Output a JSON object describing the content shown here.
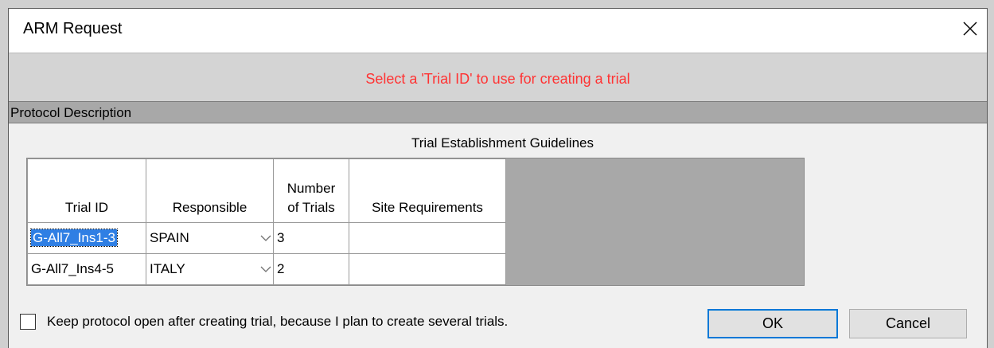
{
  "window": {
    "title": "ARM Request",
    "close_icon": "close-icon"
  },
  "banner": {
    "message": "Select a 'Trial ID' to use for creating a trial",
    "color": "#ff3333"
  },
  "section": {
    "header": "Protocol Description",
    "guidelines_title": "Trial Establishment Guidelines"
  },
  "table": {
    "columns": [
      {
        "label_line1": "",
        "label_line2": "Trial ID"
      },
      {
        "label_line1": "",
        "label_line2": "Responsible"
      },
      {
        "label_line1": "Number",
        "label_line2": "of Trials"
      },
      {
        "label_line1": "",
        "label_line2": "Site Requirements"
      }
    ],
    "rows": [
      {
        "trial_id": "G-All7_Ins1-3",
        "responsible": "SPAIN",
        "number": "3",
        "site": "",
        "selected": true
      },
      {
        "trial_id": "G-All7_Ins4-5",
        "responsible": "ITALY",
        "number": "2",
        "site": "",
        "selected": false
      }
    ]
  },
  "options": {
    "keep_open_label": "Keep protocol open after creating trial, because I plan to create several trials.",
    "keep_open_checked": false
  },
  "buttons": {
    "ok": "OK",
    "cancel": "Cancel"
  },
  "colors": {
    "accent": "#0078d7",
    "selection": "#2f7fe4"
  }
}
